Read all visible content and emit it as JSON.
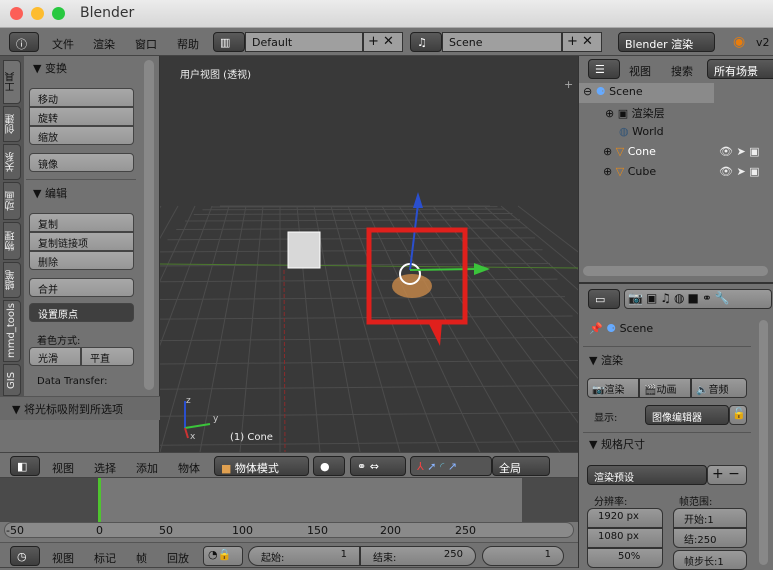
{
  "window": {
    "title": "Blender"
  },
  "topbar": {
    "menus": [
      "文件",
      "渲染",
      "窗口",
      "帮助"
    ],
    "layout": "Default",
    "scene": "Scene",
    "engine": "Blender 渲染",
    "version": "v2"
  },
  "toolshelf": {
    "tabs": [
      "工具",
      "创建",
      "关系",
      "动画",
      "物理",
      "蜡笔",
      "mmd_tools",
      "GIS"
    ],
    "transform_title": "变换",
    "transform": [
      "移动",
      "旋转",
      "缩放"
    ],
    "mirror": "镜像",
    "edit_title": "编辑",
    "edit": [
      "复制",
      "复制链接项",
      "删除"
    ],
    "join": "合并",
    "set_origin": "设置原点",
    "shading_label": "着色方式:",
    "smooth": "光滑",
    "flat": "平直",
    "data_transfer": "Data Transfer:",
    "snap_panel": "将光标吸附到所选项"
  },
  "viewport": {
    "label": "用户视图 (透视)",
    "object_label": "(1) Cone",
    "axis_x": "x",
    "axis_y": "y",
    "axis_z": "z"
  },
  "viewport_header": {
    "menus": [
      "视图",
      "选择",
      "添加",
      "物体"
    ],
    "mode": "物体模式",
    "orientation": "全局"
  },
  "outliner": {
    "menus": [
      "视图",
      "搜索"
    ],
    "filter": "所有场景",
    "items": [
      "Scene",
      "渲染层",
      "World",
      "Cone",
      "Cube"
    ]
  },
  "properties": {
    "context": "Scene",
    "render_title": "渲染",
    "render_btns": [
      "渲染",
      "动画",
      "音频"
    ],
    "display_label": "显示:",
    "display_value": "图像编辑器",
    "dimensions_title": "规格尺寸",
    "presets": "渲染预设",
    "resolution_label": "分辨率:",
    "frame_range_label": "帧范围:",
    "res_x": "1920 px",
    "res_y": "1080 px",
    "res_pct": "50%",
    "start": "开始:1",
    "end": "结:250",
    "step": "帧步长:1"
  },
  "timeline": {
    "ticks": [
      "-50",
      "0",
      "50",
      "100",
      "150",
      "200",
      "250"
    ],
    "current_frame": 0
  },
  "timeline_header": {
    "menus": [
      "视图",
      "标记",
      "帧",
      "回放"
    ],
    "start_label": "起始:",
    "start": "1",
    "end_label": "结束:",
    "end": "250",
    "current": "1"
  },
  "colors": {
    "highlight": "#e0201c",
    "accent": "#5680c2"
  }
}
